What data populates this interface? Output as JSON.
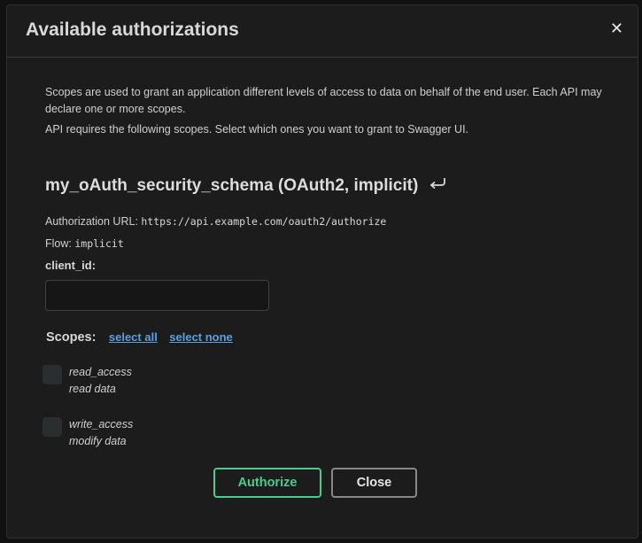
{
  "modal": {
    "title": "Available authorizations",
    "close_glyph": "✕"
  },
  "description": {
    "line1": "Scopes are used to grant an application different levels of access to data on behalf of the end user. Each API may declare one or more scopes.",
    "line2": "API requires the following scopes. Select which ones you want to grant to Swagger UI."
  },
  "scheme": {
    "title": "my_oAuth_security_schema (OAuth2, implicit)",
    "link_icon": "return-arrow-icon",
    "auth_url_label": "Authorization URL:",
    "auth_url_value": "https://api.example.com/oauth2/authorize",
    "flow_label": "Flow:",
    "flow_value": "implicit",
    "client_id_label": "client_id:",
    "client_id_value": "",
    "client_id_placeholder": ""
  },
  "scopes": {
    "label": "Scopes:",
    "select_all": "select all",
    "select_none": "select none",
    "items": [
      {
        "name": "read_access",
        "description": "read data",
        "checked": false
      },
      {
        "name": "write_access",
        "description": "modify data",
        "checked": false
      }
    ]
  },
  "buttons": {
    "authorize": "Authorize",
    "close": "Close"
  },
  "colors": {
    "authorize_border": "#49cc90",
    "link": "#5aa0e0",
    "background": "#1c1c1c"
  }
}
